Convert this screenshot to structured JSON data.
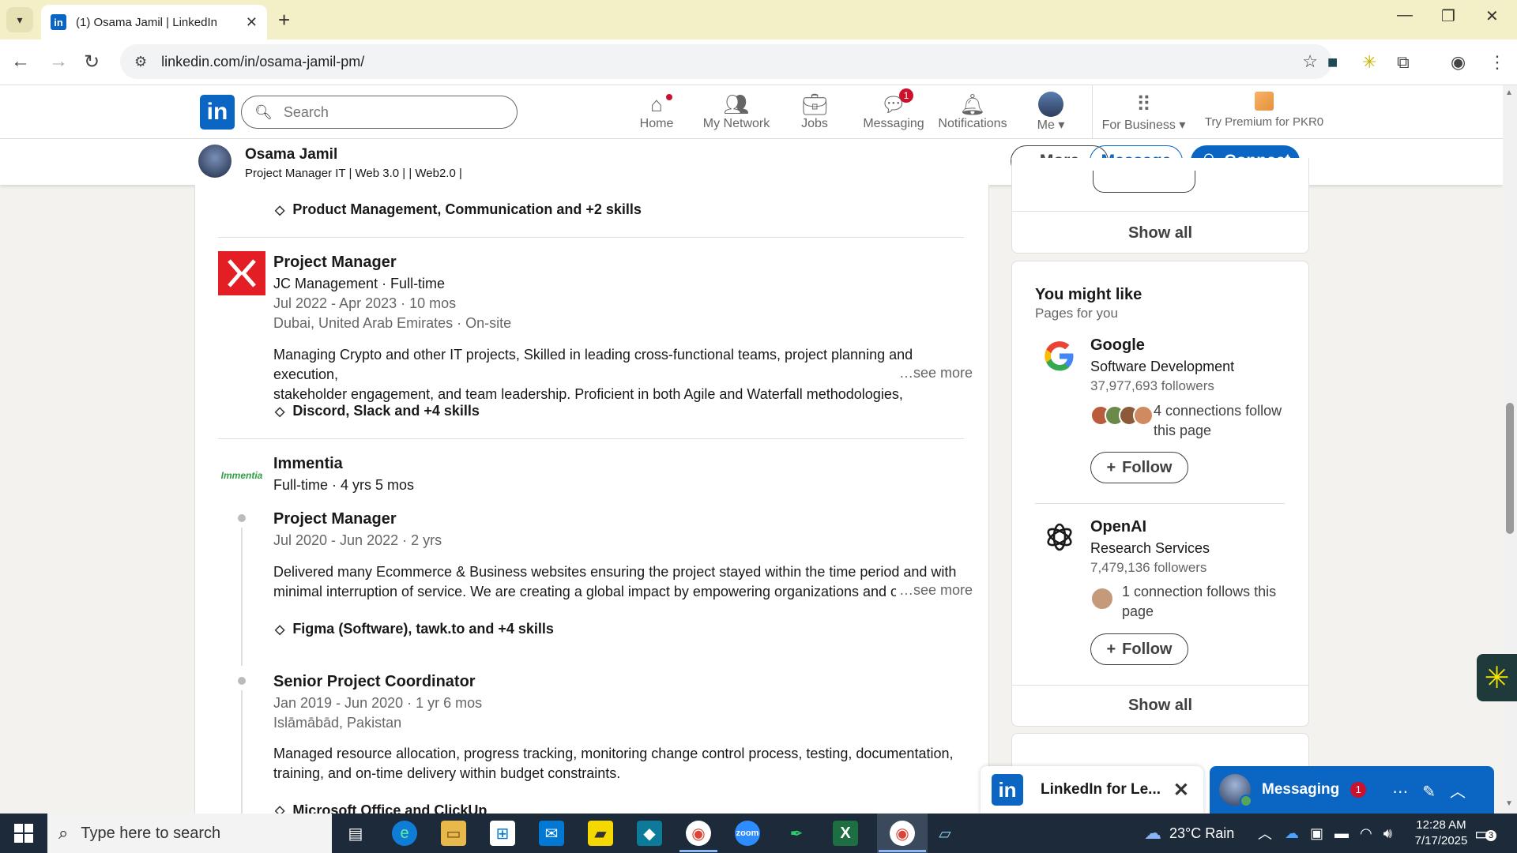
{
  "browser": {
    "tab_title": "(1) Osama Jamil | LinkedIn",
    "url": "linkedin.com/in/osama-jamil-pm/"
  },
  "linkedin_nav": {
    "search_placeholder": "Search",
    "items": [
      {
        "label": "Home",
        "icon": "home-icon",
        "badge": ""
      },
      {
        "label": "My Network",
        "icon": "network-icon",
        "badge": ""
      },
      {
        "label": "Jobs",
        "icon": "briefcase-icon",
        "badge": ""
      },
      {
        "label": "Messaging",
        "icon": "chat-icon",
        "badge": "1"
      },
      {
        "label": "Notifications",
        "icon": "bell-icon",
        "badge": ""
      },
      {
        "label": "Me",
        "icon": "avatar-icon",
        "badge": ""
      }
    ],
    "for_business": "For Business",
    "premium": "Try Premium for PKR0"
  },
  "profile_bar": {
    "name": "Osama Jamil",
    "headline": "Project Manager IT | Web 3.0 | | Web2.0 |",
    "more": "More",
    "message": "Message",
    "connect": "Connect"
  },
  "experience": {
    "top_skills": "Product Management, Communication and +2 skills",
    "jc": {
      "title": "Project Manager",
      "company": "JC Management · Full-time",
      "dates": "Jul 2022 - Apr 2023 · 10 mos",
      "location": "Dubai, United Arab Emirates · On-site",
      "desc1": "Managing Crypto and other IT projects, Skilled in leading cross-functional teams, project planning and execution,",
      "desc2": "stakeholder engagement, and team leadership. Proficient in both Agile and Waterfall methodologies,",
      "see_more": "…see more",
      "skills": "Discord, Slack and +4 skills"
    },
    "immentia": {
      "logo_text": "Immentia",
      "company": "Immentia",
      "duration": "Full-time · 4 yrs 5 mos",
      "role1": {
        "title": "Project Manager",
        "dates": "Jul 2020 - Jun 2022 · 2 yrs",
        "desc1": "Delivered many Ecommerce & Business websites ensuring the project stayed within the time period and with",
        "desc2": "minimal interruption of service. We are creating a global impact by empowering organizations and of",
        "see_more": "…see more",
        "skills": "Figma (Software), tawk.to and +4 skills"
      },
      "role2": {
        "title": "Senior Project Coordinator",
        "dates": "Jan 2019 - Jun 2020 · 1 yr 6 mos",
        "location": "Islāmābād, Pakistan",
        "desc1": "Managed resource allocation, progress tracking, monitoring change control process, testing, documentation,",
        "desc2": "training, and on-time delivery within budget constraints.",
        "skills": "Microsoft Office and ClickUp"
      }
    }
  },
  "sidebar": {
    "show_all_top": "Show all",
    "title": "You might like",
    "subtitle": "Pages for you",
    "pages": [
      {
        "name": "Google",
        "industry": "Software Development",
        "followers": "37,977,693 followers",
        "connections": "4 connections follow this page",
        "follow": "Follow"
      },
      {
        "name": "OpenAI",
        "industry": "Research Services",
        "followers": "7,479,136 followers",
        "connections": "1 connection follows this page",
        "follow": "Follow"
      }
    ],
    "show_all_bottom": "Show all"
  },
  "popups": {
    "linkedin_windows": "LinkedIn for Le...",
    "messaging": "Messaging",
    "messaging_count": "1"
  },
  "taskbar": {
    "search_placeholder": "Type here to search",
    "weather": "23°C  Rain",
    "time": "12:28 AM",
    "date": "7/17/2025",
    "notifications": "3"
  },
  "colors": {
    "linkedin_blue": "#0a66c2",
    "badge_red": "#cb112d",
    "tab_bar": "#f3efc6"
  }
}
